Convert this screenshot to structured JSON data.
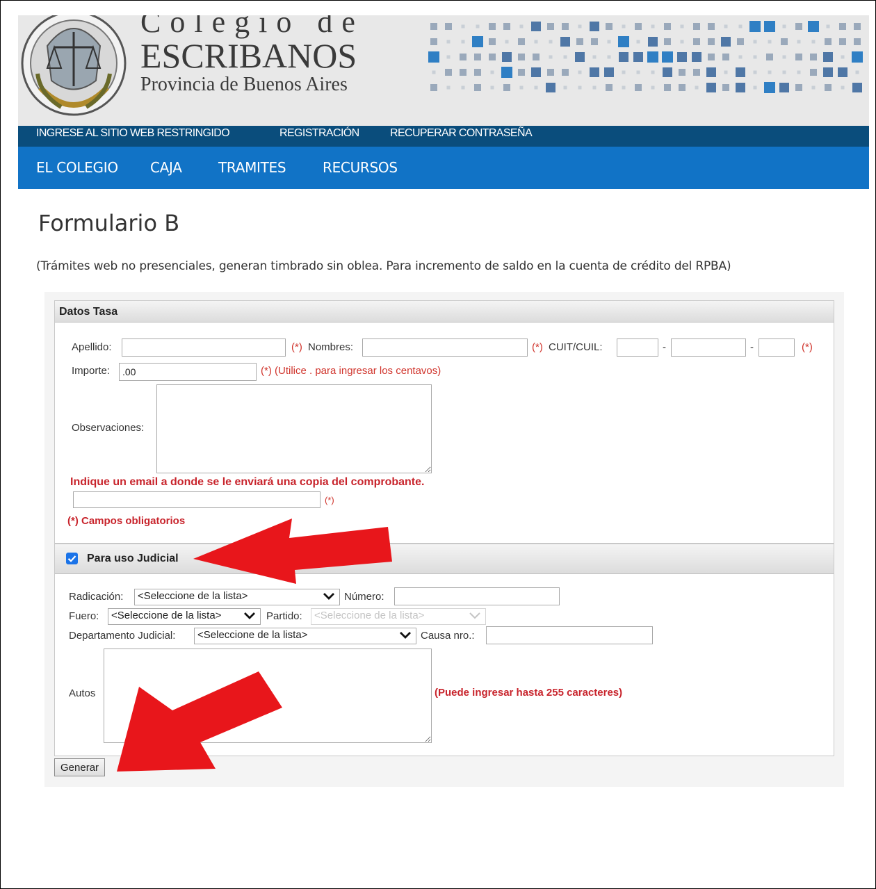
{
  "header": {
    "brand_line1": "Colegio de",
    "brand_line2": "ESCRIBANOS",
    "brand_line3": "Provincia de Buenos Aires",
    "seal_icon": "colegio-seal-icon"
  },
  "top_nav": {
    "items": [
      "INGRESE AL SITIO WEB RESTRINGIDO",
      "REGISTRACIÓN",
      "RECUPERAR CONTRASEÑA"
    ]
  },
  "main_nav": {
    "items": [
      "EL COLEGIO",
      "CAJA",
      "TRAMITES",
      "RECURSOS"
    ]
  },
  "page": {
    "title": "Formulario B",
    "subtitle": "(Trámites web no presenciales, generan timbrado sin oblea. Para incremento de saldo en la cuenta de crédito del RPBA)"
  },
  "datos_tasa": {
    "header": "Datos Tasa",
    "apellido_label": "Apellido:",
    "req_mark": "(*)",
    "nombres_label": "Nombres:",
    "cuit_label": "CUIT/CUIL:",
    "dash": "-",
    "importe_label": "Importe:",
    "importe_value": ".00",
    "importe_hint": "(*) (Utilice . para ingresar los centavos)",
    "observaciones_label": "Observaciones:",
    "email_prompt": "Indique un email a donde se le enviará una copia del comprobante.",
    "required_note": "(*) Campos obligatorios"
  },
  "judicial": {
    "header": "Para uso Judicial",
    "checked": true,
    "radicacion_label": "Radicación:",
    "radicacion_value": "<Seleccione de la lista>",
    "numero_label": "Número:",
    "fuero_label": "Fuero:",
    "fuero_value": "<Seleccione de la lista>",
    "partido_label": "Partido:",
    "partido_value": "<Seleccione de la lista>",
    "departamento_label": "Departamento Judicial:",
    "departamento_value": "<Seleccione de la lista>",
    "causa_label": "Causa nro.:",
    "autos_label": "Autos",
    "autos_hint": "(Puede ingresar hasta 255 caracteres)"
  },
  "actions": {
    "generate_label": "Generar"
  },
  "annotations": {
    "arrow_color": "#e8161b"
  }
}
